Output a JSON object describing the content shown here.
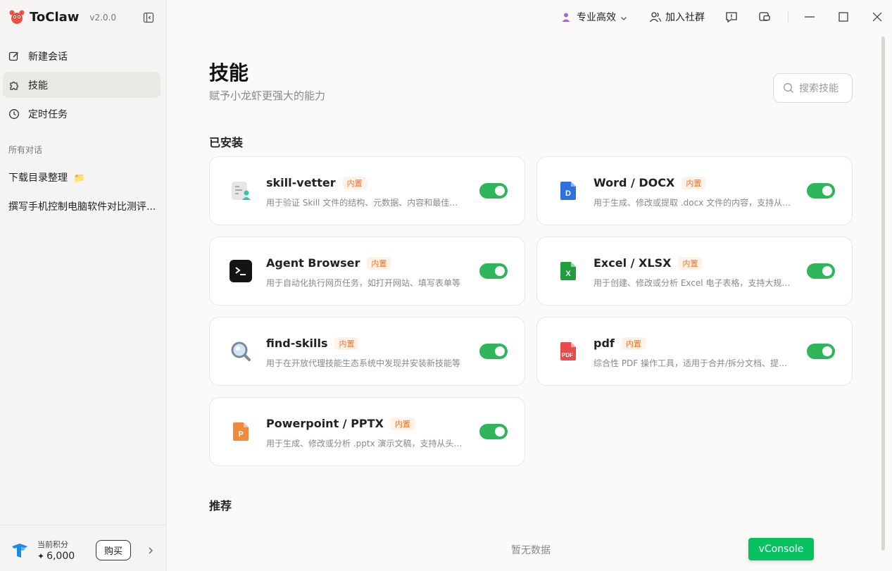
{
  "app": {
    "name": "ToClaw",
    "version": "v2.0.0"
  },
  "sidebar": {
    "nav": [
      {
        "label": "新建会话",
        "icon": "edit-icon"
      },
      {
        "label": "技能",
        "icon": "puzzle-icon",
        "active": true
      },
      {
        "label": "定时任务",
        "icon": "clock-icon"
      }
    ],
    "section_label": "所有对话",
    "conversations": [
      {
        "title": "下载目录整理",
        "emoji": "📁"
      },
      {
        "title": "撰写手机控制电脑软件对比测评..."
      }
    ],
    "points": {
      "label": "当前积分",
      "value": "6,000",
      "buy_label": "购买"
    }
  },
  "titlebar": {
    "mode_label": "专业高效",
    "community_label": "加入社群"
  },
  "page": {
    "title": "技能",
    "subtitle": "赋予小龙虾更强大的能力",
    "search_placeholder": "搜索技能",
    "installed_title": "已安装",
    "recommended_title": "推荐",
    "empty_text": "暂无数据"
  },
  "skills": [
    {
      "name": "skill-vetter",
      "badge": "内置",
      "desc": "用于验证 Skill 文件的结构、元数据、内容和最佳实践",
      "icon": "checklist-icon",
      "enabled": true
    },
    {
      "name": "Word / DOCX",
      "badge": "内置",
      "desc": "用于生成、修改或提取 .docx 文件的内容，支持从头创建",
      "icon": "word-icon",
      "enabled": true
    },
    {
      "name": "Agent Browser",
      "badge": "内置",
      "desc": "用于自动化执行网页任务，如打开网站、填写表单等",
      "icon": "terminal-icon",
      "enabled": true
    },
    {
      "name": "Excel / XLSX",
      "badge": "内置",
      "desc": "用于创建、修改或分析 Excel 电子表格，支持大规模数据",
      "icon": "excel-icon",
      "enabled": true
    },
    {
      "name": "find-skills",
      "badge": "内置",
      "desc": "用于在开放代理技能生态系统中发现并安装新技能等",
      "icon": "magnifier-icon",
      "enabled": true
    },
    {
      "name": "pdf",
      "badge": "内置",
      "desc": "综合性 PDF 操作工具，适用于合并/拆分文档、提取内容",
      "icon": "pdf-icon",
      "enabled": true
    },
    {
      "name": "Powerpoint / PPTX",
      "badge": "内置",
      "desc": "用于生成、修改或分析 .pptx 演示文稿，支持从头构建",
      "icon": "ppt-icon",
      "enabled": true
    }
  ],
  "vconsole_label": "vConsole"
}
